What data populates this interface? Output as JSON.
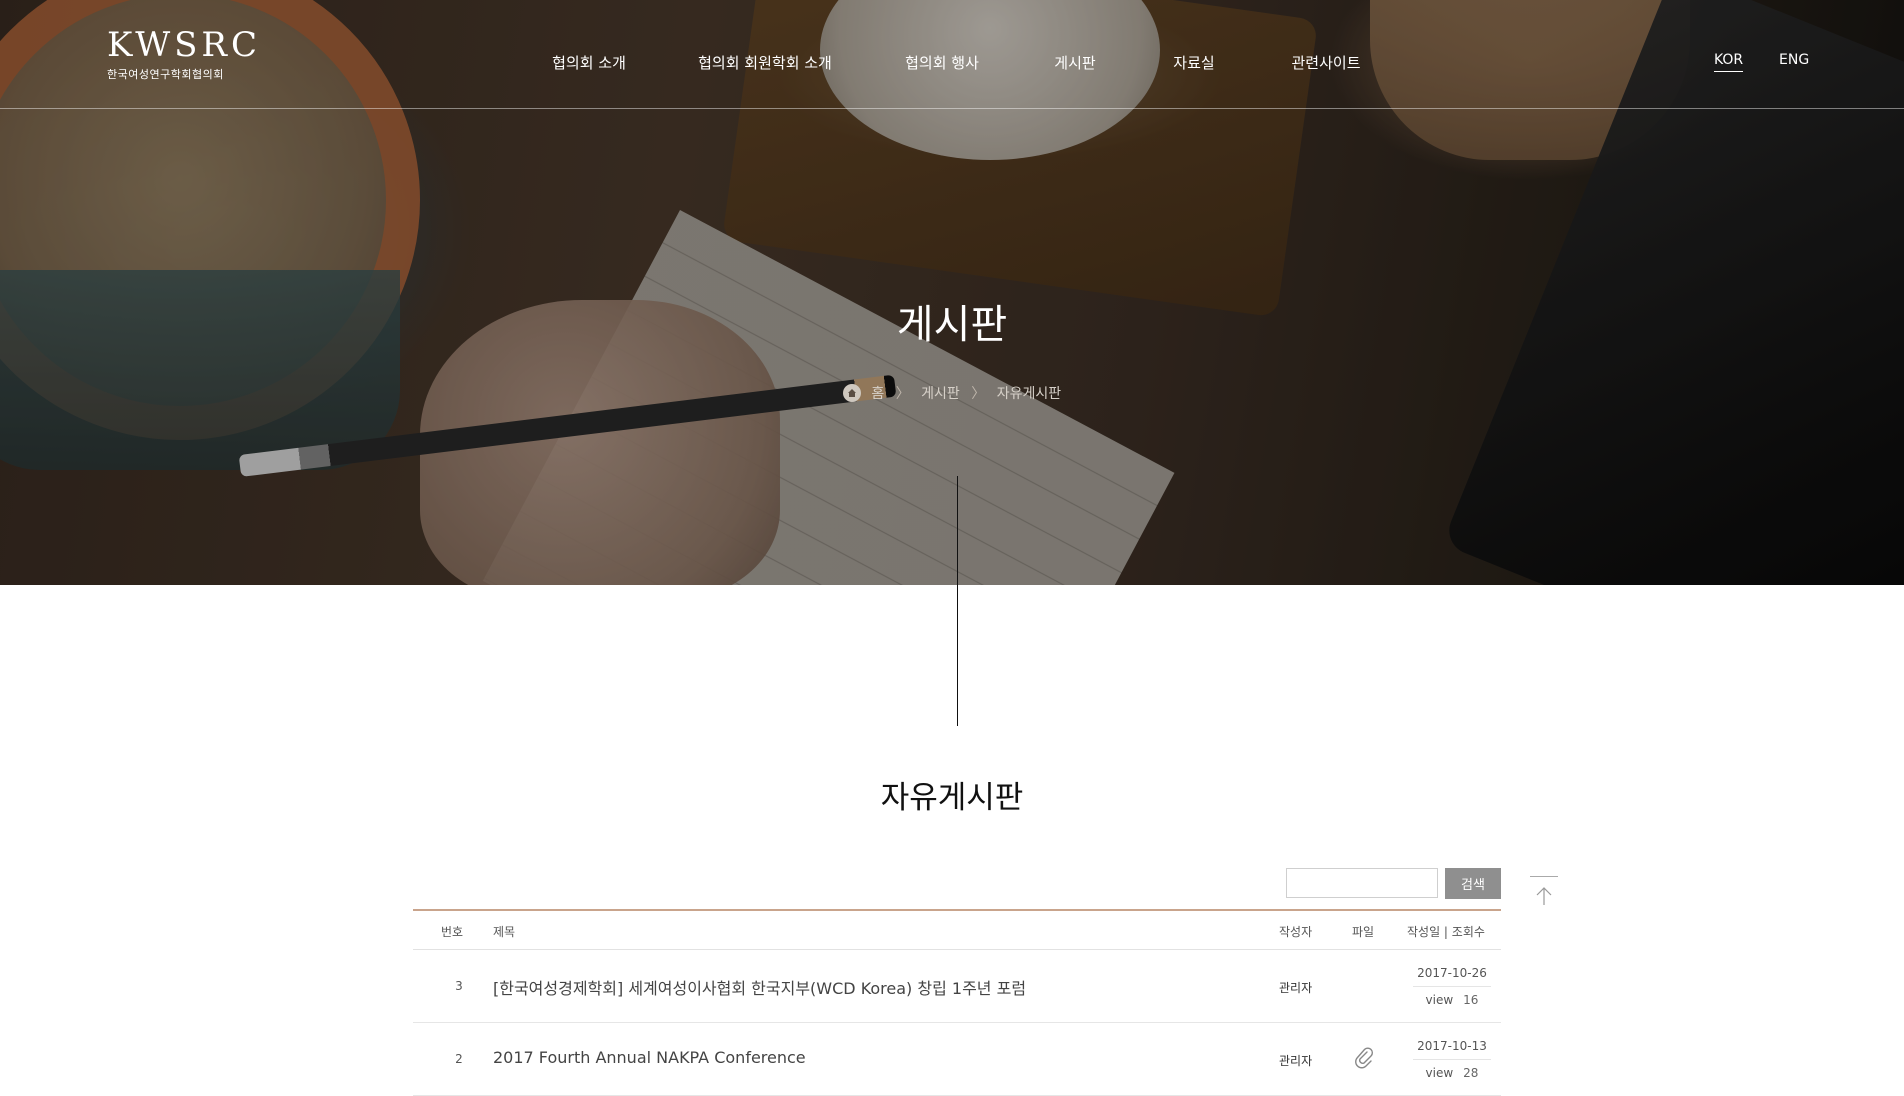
{
  "header": {
    "logo_mark": "KWSRC",
    "logo_sub": "한국여성연구학회협의회",
    "nav": [
      {
        "label": "협의회 소개"
      },
      {
        "label": "협의회 회원학회 소개"
      },
      {
        "label": "협의회 행사"
      },
      {
        "label": "게시판"
      },
      {
        "label": "자료실"
      },
      {
        "label": "관련사이트"
      }
    ],
    "lang": {
      "kor": "KOR",
      "eng": "ENG",
      "active": "KOR"
    }
  },
  "hero": {
    "title": "게시판",
    "breadcrumb": [
      "홈",
      "게시판",
      "자유게시판"
    ],
    "sep": "〉"
  },
  "board": {
    "title": "자유게시판",
    "search": {
      "value": "",
      "placeholder": "",
      "button": "검색"
    },
    "columns": {
      "num": "번호",
      "subject": "제목",
      "author": "작성자",
      "file": "파일",
      "date_views": "작성일 | 조회수"
    },
    "rows": [
      {
        "num": "3",
        "subject": "[한국여성경제학회] 세계여성이사협회 한국지부(WCD Korea) 창립 1주년 포럼",
        "author": "관리자",
        "has_file": false,
        "date": "2017-10-26",
        "view_label": "view",
        "views": "16"
      },
      {
        "num": "2",
        "subject": "2017 Fourth Annual NAKPA Conference",
        "author": "관리자",
        "has_file": true,
        "date": "2017-10-13",
        "view_label": "view",
        "views": "28"
      }
    ]
  },
  "colors": {
    "accent_line": "#c9a48c",
    "search_button": "#8f8f8f"
  }
}
